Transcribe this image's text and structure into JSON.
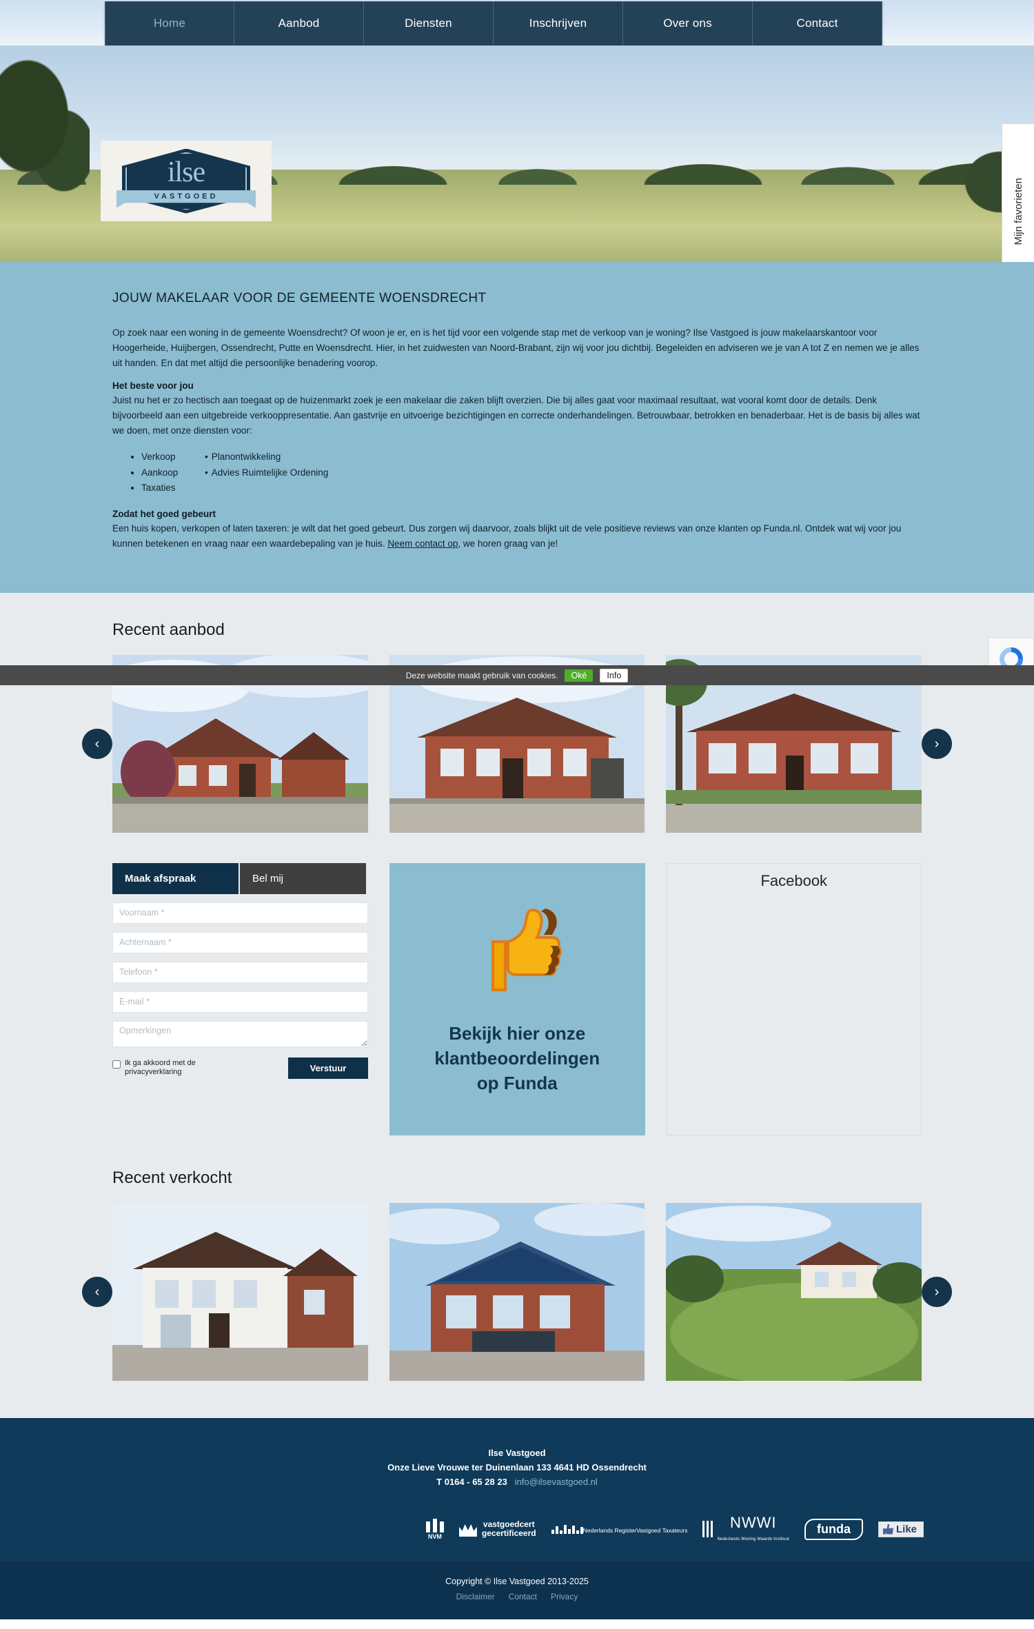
{
  "nav": {
    "items": [
      {
        "label": "Home",
        "active": true
      },
      {
        "label": "Aanbod",
        "active": false
      },
      {
        "label": "Diensten",
        "active": false
      },
      {
        "label": "Inschrijven",
        "active": false
      },
      {
        "label": "Over ons",
        "active": false
      },
      {
        "label": "Contact",
        "active": false
      }
    ]
  },
  "favorites_tab": {
    "label": "Mijn favorieten"
  },
  "logo": {
    "word": "ilse",
    "ribbon": "VASTGOED"
  },
  "intro": {
    "heading": "JOUW MAKELAAR VOOR DE GEMEENTE WOENSDRECHT",
    "paragraph1": "Op zoek naar een woning in de gemeente Woensdrecht? Of woon je er, en is het tijd voor een volgende stap met de verkoop van je woning? Ilse Vastgoed is jouw makelaarskantoor voor Hoogerheide, Huijbergen, Ossendrecht, Putte en Woensdrecht. Hier, in het zuidwesten van Noord-Brabant, zijn wij voor jou dichtbij. Begeleiden en adviseren we je van A tot Z en nemen we je alles uit handen. En dat met altijd die persoonlijke benadering voorop.",
    "subheading1": "Het beste voor jou",
    "paragraph2": "Juist nu het er zo hectisch aan toegaat op de huizenmarkt zoek je een makelaar die zaken blijft overzien. Die bij alles gaat voor maximaal resultaat, wat vooral komt door de details. Denk bijvoorbeeld aan een uitgebreide verkooppresentatie. Aan gastvrije en uitvoerige bezichtigingen en correcte onderhandelingen. Betrouwbaar, betrokken en benaderbaar. Het is de basis bij alles wat we doen, met onze diensten voor:",
    "services_left": [
      "Verkoop",
      "Aankoop",
      "Taxaties"
    ],
    "services_right": [
      "Planontwikkeling",
      "Advies Ruimtelijke Ordening"
    ],
    "subheading2": "Zodat het goed gebeurt",
    "paragraph3_before": "Een huis kopen, verkopen of laten taxeren: je wilt dat het goed gebeurt. Dus zorgen wij daarvoor, zoals blijkt uit de vele positieve reviews van onze klanten op Funda.nl. Ontdek wat wij voor jou kunnen betekenen en vraag naar een waardebepaling van je huis. ",
    "paragraph3_link": "Neem contact op",
    "paragraph3_after": ", we horen graag van je!"
  },
  "cookiebar": {
    "text": "Deze website maakt gebruik van cookies.",
    "accept": "Oké",
    "info": "Info"
  },
  "recent_aanbod": {
    "title": "Recent aanbod",
    "prev": "‹",
    "next": "›",
    "items": [
      {
        "name": "listing-1"
      },
      {
        "name": "listing-2"
      },
      {
        "name": "listing-3"
      }
    ]
  },
  "contact_form": {
    "tab_appointment": "Maak afspraak",
    "tab_callme": "Bel mij",
    "fields": [
      {
        "name": "voornaam",
        "placeholder": "Voornaam *",
        "value": ""
      },
      {
        "name": "achternaam",
        "placeholder": "Achternaam *",
        "value": ""
      },
      {
        "name": "telefoon",
        "placeholder": "Telefoon *",
        "value": ""
      },
      {
        "name": "email",
        "placeholder": "E-mail *",
        "value": ""
      }
    ],
    "comments_placeholder": "Opmerkingen",
    "comments_value": "",
    "agree_label": "Ik ga akkoord met de privacyverklaring",
    "submit": "Verstuur"
  },
  "promo": {
    "line1": "Bekijk hier onze",
    "line2": "klantbeoordelingen",
    "line3": "op Funda"
  },
  "facebook": {
    "title": "Facebook"
  },
  "recent_verkocht": {
    "title": "Recent verkocht",
    "prev": "‹",
    "next": "›",
    "items": [
      {
        "name": "sold-1"
      },
      {
        "name": "sold-2"
      },
      {
        "name": "sold-3"
      }
    ]
  },
  "footer": {
    "company": "Ilse Vastgoed",
    "address": "Onze Lieve Vrouwe ter Duinenlaan 133 4641 HD Ossendrecht",
    "phone": "T 0164 - 65 28 23",
    "email": "info@ilsevastgoed.nl",
    "partners": {
      "nvm": "NVM",
      "vastgoedcert_1": "vastgoedcert",
      "vastgoedcert_2": "gecertificeerd",
      "nrvt_1": "Nederlands Register",
      "nrvt_2": "Vastgoed Taxateurs",
      "nwwi": "NWWI",
      "nwwi_sub": "Nederlands Woning Waarde Instituut",
      "funda": "funda",
      "like": "Like"
    }
  },
  "copyright": {
    "text": "Copyright © Ilse Vastgoed 2013-2025",
    "links": [
      "Disclaimer",
      "Contact",
      "Privacy"
    ]
  },
  "colors": {
    "nav_bg": "#234258",
    "nav_active_text": "#8fb6cf",
    "intro_bg": "#8bbcd0",
    "section_bg": "#e8ebed",
    "footer_bg": "#0f3a59",
    "copyright_bg": "#0c3250",
    "accent_dark": "#0e3149",
    "cookie_accept": "#4caf27"
  }
}
